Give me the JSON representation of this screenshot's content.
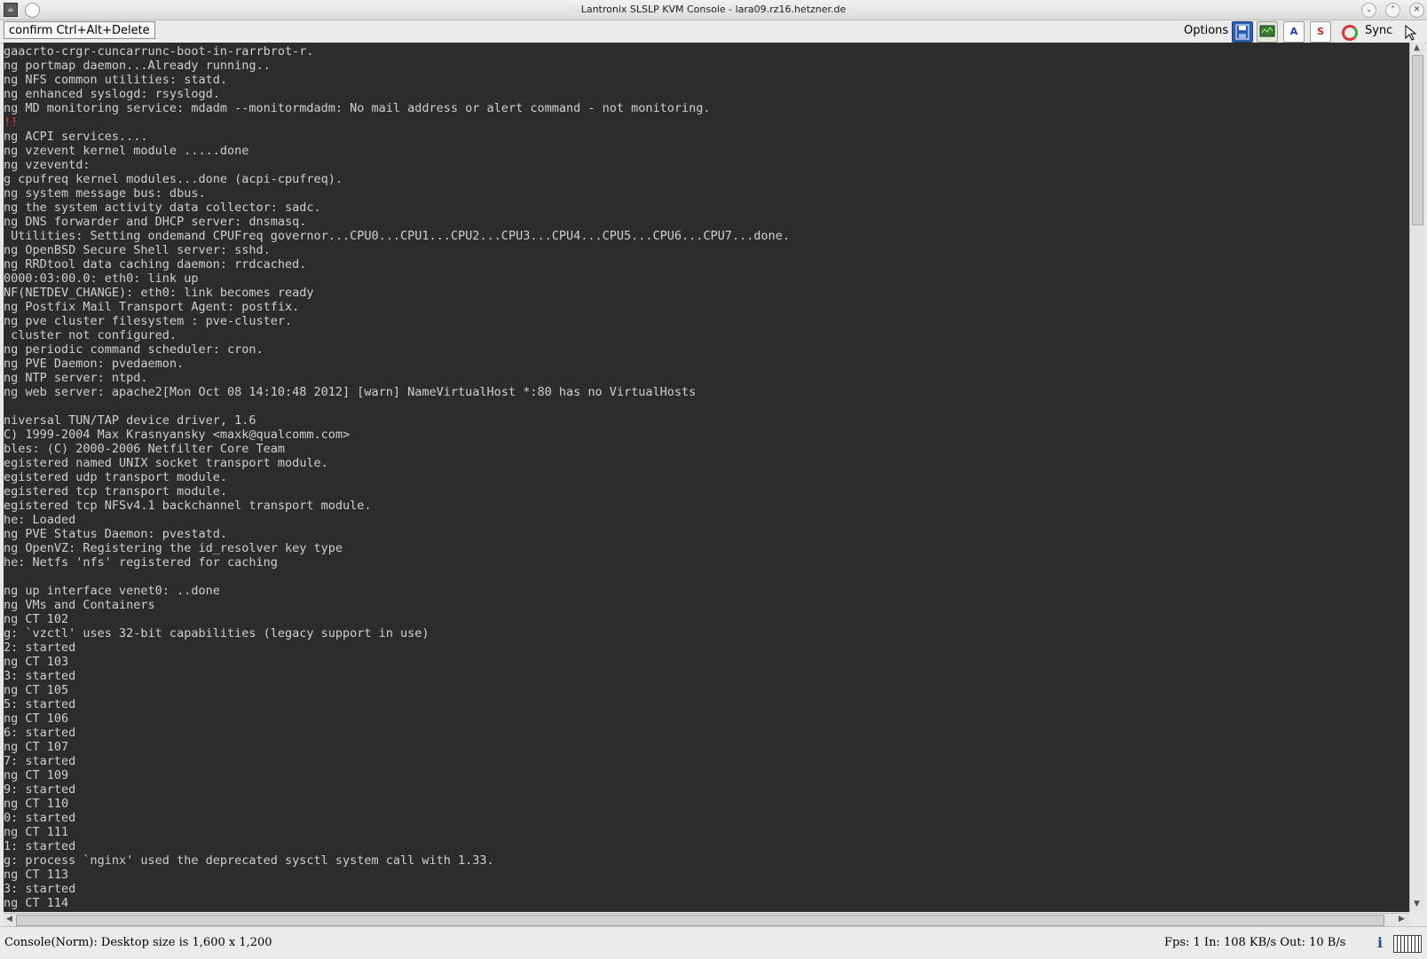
{
  "window": {
    "title": "Lantronix SLSLP KVM Console - lara09.rz16.hetzner.de",
    "app_icon_glyph": "☕",
    "controls": {
      "minimize": "⌄",
      "maximize": "⌃",
      "close": "✕"
    }
  },
  "toolbar": {
    "cad_label": "confirm Ctrl+Alt+Delete",
    "options_label": "Options",
    "sync_label": "Sync",
    "icons": [
      "save-icon",
      "monitor-icon",
      "text-a-icon",
      "text-s-icon",
      "sync-icon",
      "cursor-icon"
    ],
    "icon_a": "A",
    "icon_s": "S"
  },
  "console": {
    "lines": [
      "gaacrto-crgr-cuncarrunc-boot-in-rarrbrot-r.",
      "ng portmap daemon...Already running..",
      "ng NFS common utilities: statd.",
      "ng enhanced syslogd: rsyslogd.",
      "ng MD monitoring service: mdadm --monitormdadm: No mail address or alert command - not monitoring.",
      "!!",
      "ng ACPI services....",
      "ng vzevent kernel module .....done",
      "ng vzeventd:",
      "g cpufreq kernel modules...done (acpi-cpufreq).",
      "ng system message bus: dbus.",
      "ng the system activity data collector: sadc.",
      "ng DNS forwarder and DHCP server: dnsmasq.",
      " Utilities: Setting ondemand CPUFreq governor...CPU0...CPU1...CPU2...CPU3...CPU4...CPU5...CPU6...CPU7...done.",
      "ng OpenBSD Secure Shell server: sshd.",
      "ng RRDtool data caching daemon: rrdcached.",
      "0000:03:00.0: eth0: link up",
      "NF(NETDEV_CHANGE): eth0: link becomes ready",
      "ng Postfix Mail Transport Agent: postfix.",
      "ng pve cluster filesystem : pve-cluster.",
      " cluster not configured.",
      "ng periodic command scheduler: cron.",
      "ng PVE Daemon: pvedaemon.",
      "ng NTP server: ntpd.",
      "ng web server: apache2[Mon Oct 08 14:10:48 2012] [warn] NameVirtualHost *:80 has no VirtualHosts",
      "",
      "niversal TUN/TAP device driver, 1.6",
      "C) 1999-2004 Max Krasnyansky <maxk@qualcomm.com>",
      "bles: (C) 2000-2006 Netfilter Core Team",
      "egistered named UNIX socket transport module.",
      "egistered udp transport module.",
      "egistered tcp transport module.",
      "egistered tcp NFSv4.1 backchannel transport module.",
      "he: Loaded",
      "ng PVE Status Daemon: pvestatd.",
      "ng OpenVZ: Registering the id_resolver key type",
      "he: Netfs 'nfs' registered for caching",
      "",
      "ng up interface venet0: ..done",
      "ng VMs and Containers",
      "ng CT 102",
      "g: `vzctl' uses 32-bit capabilities (legacy support in use)",
      "2: started",
      "ng CT 103",
      "3: started",
      "ng CT 105",
      "5: started",
      "ng CT 106",
      "6: started",
      "ng CT 107",
      "7: started",
      "ng CT 109",
      "9: started",
      "ng CT 110",
      "0: started",
      "ng CT 111",
      "1: started",
      "g: process `nginx' used the deprecated sysctl system call with 1.33.",
      "ng CT 113",
      "3: started",
      "ng CT 114"
    ],
    "error_line_index": 5
  },
  "status": {
    "left": "Console(Norm): Desktop size is 1,600 x 1,200",
    "right": "Fps: 1 In: 108 KB/s Out: 10 B/s",
    "icons": [
      "info-icon",
      "keyboard-icon"
    ],
    "info_glyph": "i"
  },
  "colors": {
    "console_bg": "#2c2c2c",
    "console_text": "#cfcfcf",
    "error_text": "#d84040"
  }
}
